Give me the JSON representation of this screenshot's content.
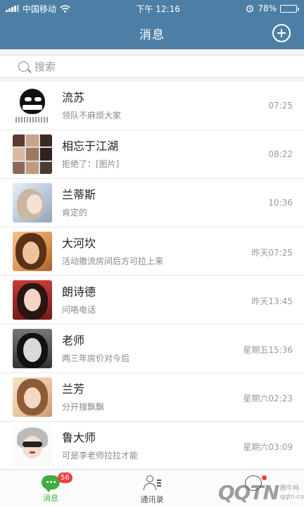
{
  "status_bar": {
    "carrier": "中国移动",
    "time": "下午 12:16",
    "battery": "78%",
    "battery_level": 0.78,
    "icons": [
      "signal-icon",
      "wifi-icon",
      "alarm-icon",
      "battery-icon"
    ]
  },
  "header": {
    "title": "消息",
    "add_icon": "plus-circle-icon",
    "color": "#4d7fa6"
  },
  "search": {
    "placeholder": "搜索",
    "icon": "search-icon"
  },
  "conversations": [
    {
      "name": "流苏",
      "preview": "领队不麻烦大家",
      "time": "07:25"
    },
    {
      "name": "相忘于江湖",
      "preview": "拒绝了：[图片]",
      "time": "08:22"
    },
    {
      "name": "兰蒂斯",
      "preview": "肯定的",
      "time": "10:36"
    },
    {
      "name": "大河坎",
      "preview": "活动撤流房间后方可拉上来",
      "time": "昨天07:25"
    },
    {
      "name": "朗诗德",
      "preview": "问咯电话",
      "time": "昨天13:45"
    },
    {
      "name": "老师",
      "preview": "两三年房价对今后",
      "time": "星期五15:36"
    },
    {
      "name": "兰芳",
      "preview": "分开搜飘飘",
      "time": "星期六02:23"
    },
    {
      "name": "鲁大师",
      "preview": "可是李老师拉拉才能",
      "time": "星期六03:09"
    }
  ],
  "tabbar": {
    "tabs": [
      {
        "label": "消息",
        "icon": "chat-bubble-icon",
        "badge": "56",
        "active": true
      },
      {
        "label": "通讯录",
        "icon": "contacts-icon",
        "active": false
      },
      {
        "label": "",
        "icon": "profile-icon",
        "active": false
      }
    ],
    "active_color": "#3fae3f",
    "badge_color": "#f04040"
  },
  "watermark": {
    "logo": "QQTN",
    "site": "腾牛网",
    "url": "qqtn.com"
  }
}
